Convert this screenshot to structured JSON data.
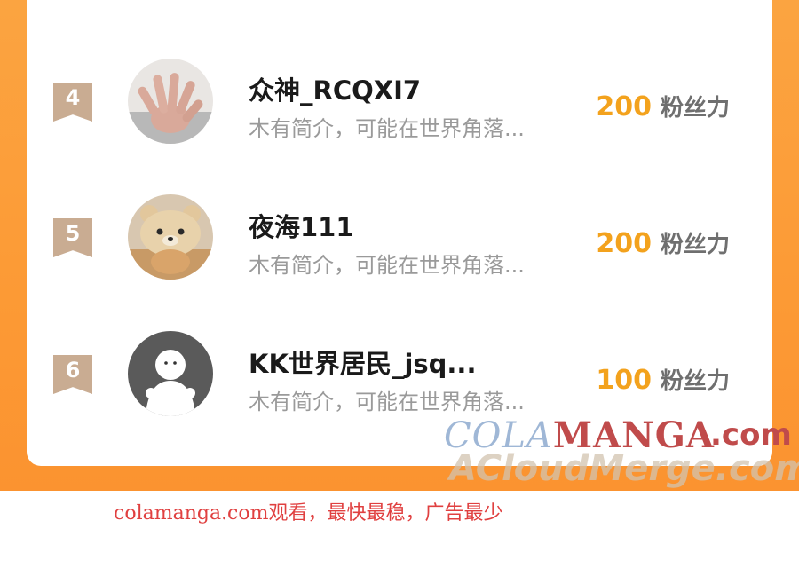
{
  "rows": [
    {
      "rank": "4",
      "name": "众神_RCQXI7",
      "bio": "木有简介，可能在世界角落...",
      "fans_value": "200",
      "fans_unit": "粉丝力",
      "avatar": "hand-photo-avatar"
    },
    {
      "rank": "5",
      "name": "夜海111",
      "bio": "木有简介，可能在世界角落...",
      "fans_value": "200",
      "fans_unit": "粉丝力",
      "avatar": "bear-hat-cat-avatar"
    },
    {
      "rank": "6",
      "name": "KK世界居民_jsq...",
      "bio": "木有简介，可能在世界角落...",
      "fans_value": "100",
      "fans_unit": "粉丝力",
      "avatar": "default-person-avatar"
    }
  ],
  "watermark": {
    "cola": "COLA",
    "manga": "MANGA",
    "com": ".com",
    "acloud": "ACloudMerge.com"
  },
  "footer": "colamanga.com观看，最快最稳，广告最少",
  "colors": {
    "background_orange": "#fba441",
    "fans_value": "#f3a21d",
    "rank_badge": "#c9ac92",
    "footer_text": "#e04040"
  }
}
